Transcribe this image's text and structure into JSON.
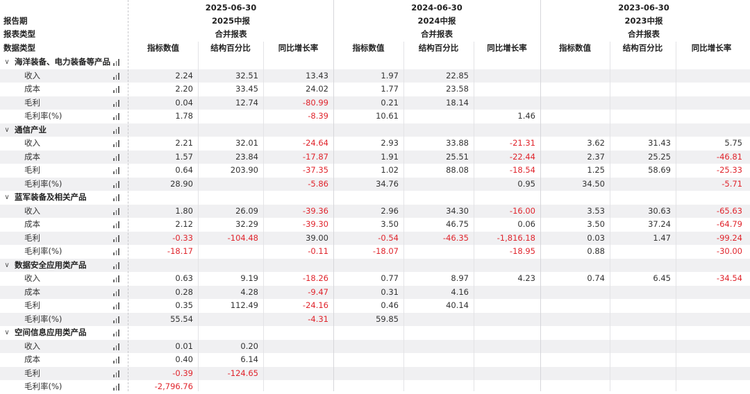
{
  "header": {
    "left_labels": [
      "报告期",
      "报表类型",
      "数据类型"
    ],
    "periods": [
      {
        "date": "2025-06-30",
        "report": "2025中报",
        "type": "合并报表"
      },
      {
        "date": "2024-06-30",
        "report": "2024中报",
        "type": "合并报表"
      },
      {
        "date": "2023-06-30",
        "report": "2023中报",
        "type": "合并报表"
      }
    ],
    "col_labels": [
      "指标数值",
      "结构百分比",
      "同比增长率"
    ]
  },
  "icons": {
    "expand": "chevron-down-icon",
    "chart": "bar-chart-icon"
  },
  "colors": {
    "negative": "#e0242c",
    "stripe": "#f0f0f2"
  },
  "groups": [
    {
      "name": "海洋装备、电力装备等产品",
      "rows": [
        {
          "label": "收入",
          "values": [
            "2.24",
            "32.51",
            "13.43",
            "1.97",
            "22.85",
            "",
            "",
            "",
            ""
          ]
        },
        {
          "label": "成本",
          "values": [
            "2.20",
            "33.45",
            "24.02",
            "1.77",
            "23.58",
            "",
            "",
            "",
            ""
          ]
        },
        {
          "label": "毛利",
          "values": [
            "0.04",
            "12.74",
            "-80.99",
            "0.21",
            "18.14",
            "",
            "",
            "",
            ""
          ]
        },
        {
          "label": "毛利率(%)",
          "values": [
            "1.78",
            "",
            "-8.39",
            "10.61",
            "",
            "1.46",
            "",
            "",
            ""
          ]
        }
      ]
    },
    {
      "name": "通信产业",
      "rows": [
        {
          "label": "收入",
          "values": [
            "2.21",
            "32.01",
            "-24.64",
            "2.93",
            "33.88",
            "-21.31",
            "3.62",
            "31.43",
            "5.75"
          ]
        },
        {
          "label": "成本",
          "values": [
            "1.57",
            "23.84",
            "-17.87",
            "1.91",
            "25.51",
            "-22.44",
            "2.37",
            "25.25",
            "-46.81"
          ]
        },
        {
          "label": "毛利",
          "values": [
            "0.64",
            "203.90",
            "-37.35",
            "1.02",
            "88.08",
            "-18.54",
            "1.25",
            "58.69",
            "-25.33"
          ]
        },
        {
          "label": "毛利率(%)",
          "values": [
            "28.90",
            "",
            "-5.86",
            "34.76",
            "",
            "0.95",
            "34.50",
            "",
            "-5.71"
          ]
        }
      ]
    },
    {
      "name": "蓝军装备及相关产品",
      "rows": [
        {
          "label": "收入",
          "values": [
            "1.80",
            "26.09",
            "-39.36",
            "2.96",
            "34.30",
            "-16.00",
            "3.53",
            "30.63",
            "-65.63"
          ]
        },
        {
          "label": "成本",
          "values": [
            "2.12",
            "32.29",
            "-39.30",
            "3.50",
            "46.75",
            "0.06",
            "3.50",
            "37.24",
            "-64.79"
          ]
        },
        {
          "label": "毛利",
          "values": [
            "-0.33",
            "-104.48",
            "39.00",
            "-0.54",
            "-46.35",
            "-1,816.18",
            "0.03",
            "1.47",
            "-99.24"
          ]
        },
        {
          "label": "毛利率(%)",
          "values": [
            "-18.17",
            "",
            "-0.11",
            "-18.07",
            "",
            "-18.95",
            "0.88",
            "",
            "-30.00"
          ]
        }
      ]
    },
    {
      "name": "数据安全应用类产品",
      "rows": [
        {
          "label": "收入",
          "values": [
            "0.63",
            "9.19",
            "-18.26",
            "0.77",
            "8.97",
            "4.23",
            "0.74",
            "6.45",
            "-34.54"
          ]
        },
        {
          "label": "成本",
          "values": [
            "0.28",
            "4.28",
            "-9.47",
            "0.31",
            "4.16",
            "",
            "",
            "",
            ""
          ]
        },
        {
          "label": "毛利",
          "values": [
            "0.35",
            "112.49",
            "-24.16",
            "0.46",
            "40.14",
            "",
            "",
            "",
            ""
          ]
        },
        {
          "label": "毛利率(%)",
          "values": [
            "55.54",
            "",
            "-4.31",
            "59.85",
            "",
            "",
            "",
            "",
            ""
          ]
        }
      ]
    },
    {
      "name": "空间信息应用类产品",
      "rows": [
        {
          "label": "收入",
          "values": [
            "0.01",
            "0.20",
            "",
            "",
            "",
            "",
            "",
            "",
            ""
          ]
        },
        {
          "label": "成本",
          "values": [
            "0.40",
            "6.14",
            "",
            "",
            "",
            "",
            "",
            "",
            ""
          ]
        },
        {
          "label": "毛利",
          "values": [
            "-0.39",
            "-124.65",
            "",
            "",
            "",
            "",
            "",
            "",
            ""
          ]
        },
        {
          "label": "毛利率(%)",
          "values": [
            "-2,796.76",
            "",
            "",
            "",
            "",
            "",
            "",
            "",
            ""
          ]
        }
      ]
    }
  ]
}
